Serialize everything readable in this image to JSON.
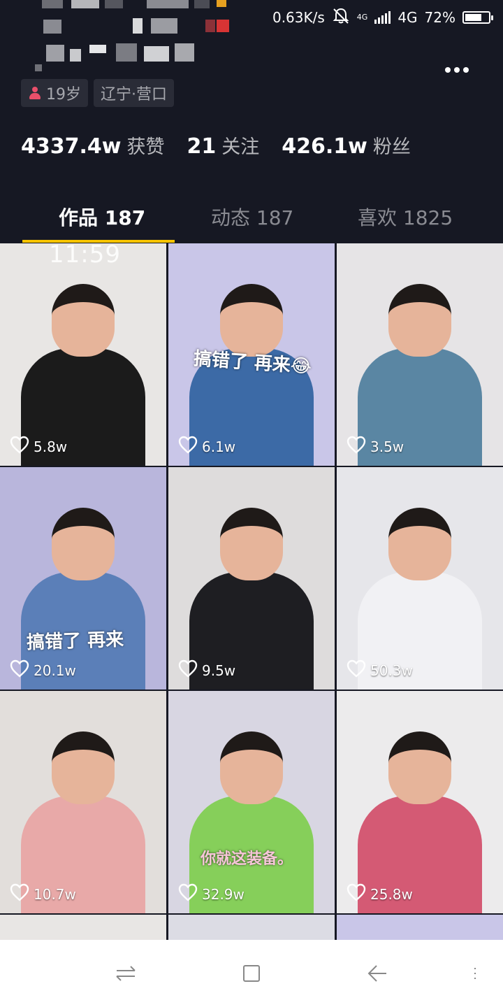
{
  "status_bar": {
    "net_speed": "0.63K/s",
    "net_type_small": "4G",
    "net_type": "4G",
    "battery": "72%",
    "battery_level": 0.72
  },
  "profile": {
    "tags": [
      "19岁",
      "辽宁·营口"
    ],
    "stats": [
      {
        "num": "4337.4w",
        "label": "获赞"
      },
      {
        "num": "21",
        "label": "关注"
      },
      {
        "num": "426.1w",
        "label": "粉丝"
      }
    ]
  },
  "tabs": [
    {
      "label": "作品 187",
      "active": true
    },
    {
      "label": "动态 187",
      "active": false
    },
    {
      "label": "喜欢 1825",
      "active": false
    }
  ],
  "videos": [
    {
      "likes": "5.8w",
      "overlay": "11:59",
      "bg": "#e8e6e4",
      "shirt": "#1b1b1b"
    },
    {
      "likes": "6.1w",
      "overlay": "搞错了 再来😂",
      "bg": "#c9c6e8",
      "shirt": "#3c6aa6"
    },
    {
      "likes": "3.5w",
      "overlay": "",
      "bg": "#e6e4e6",
      "shirt": "#5a86a3"
    },
    {
      "likes": "20.1w",
      "overlay": "搞错了 再来",
      "bg": "#b9b6dc",
      "shirt": "#5b7fb8"
    },
    {
      "likes": "9.5w",
      "overlay": "",
      "bg": "#dedcdc",
      "shirt": "#1e1e22"
    },
    {
      "likes": "50.3w",
      "overlay": "",
      "bg": "#e6e6ea",
      "shirt": "#f1f1f4"
    },
    {
      "likes": "10.7w",
      "overlay": "",
      "bg": "#e2dedb",
      "shirt": "#e8a9a8"
    },
    {
      "likes": "32.9w",
      "overlay": "你就这装备。",
      "bg": "#d8d6e2",
      "shirt": "#86cf5a"
    },
    {
      "likes": "25.8w",
      "overlay": "",
      "bg": "#ecebec",
      "shirt": "#d45a74"
    }
  ],
  "icons": {
    "more": "more-icon",
    "like": "heart-outline-icon",
    "mute": "bell-off-icon",
    "nav": [
      "switch-icon",
      "home-square-icon",
      "back-icon",
      "menu-icon"
    ]
  },
  "colors": {
    "background": "#161823",
    "tab_underline": "#f8c400",
    "tag_bg": "#2a2c37"
  }
}
